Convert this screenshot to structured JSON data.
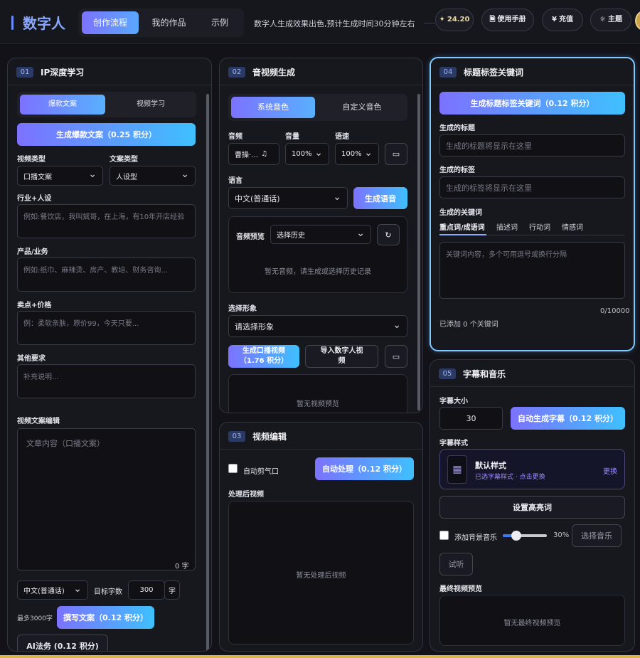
{
  "header": {
    "brand": "数字人",
    "tabs": [
      {
        "label": "创作流程",
        "active": true
      },
      {
        "label": "我的作品",
        "active": false
      },
      {
        "label": "示例",
        "active": false
      }
    ],
    "slogan": "数字人生成效果出色,预计生成时间30分钟左右",
    "credits": "24.20",
    "manual": "使用手册",
    "recharge": "充值",
    "theme": "主题"
  },
  "p1": {
    "num": "01",
    "title": "IP深度学习",
    "seg": [
      "爆款文案",
      "视频学习"
    ],
    "gen_button": "生成爆款文案（0.25 积分）",
    "video_type_label": "视频类型",
    "video_type_value": "口播文案",
    "copy_type_label": "文案类型",
    "copy_type_value": "人设型",
    "industry_label": "行业+人设",
    "industry_placeholder": "例如:餐饮店，我叫斌哥，在上海，有10年开店经验",
    "product_label": "产品/业务",
    "product_placeholder": "例如:纸巾、麻辣烫、房产、教培、财务咨询...",
    "selling_label": "卖点+价格",
    "selling_placeholder": "例：柔软亲肤，原价99，今天只要...",
    "other_label": "其他要求",
    "other_placeholder": "补充说明...",
    "editor_label": "视频文案编辑",
    "editor_placeholder": "文章内容（口播文案）",
    "char_count": "0 字",
    "lang_value": "中文(普通话)",
    "target_label": "目标字数",
    "target_value": "300",
    "unit": "字",
    "max_note": "最多3000字",
    "write_button": "撰写文案（0.12 积分）",
    "legal_button": "AI法务 (0.12 积分)"
  },
  "p2": {
    "num": "02",
    "title": "音视频生成",
    "seg": [
      "系统音色",
      "自定义音色"
    ],
    "audio_label": "音频",
    "audio_value": "曹操·…",
    "volume_label": "音量",
    "volume_value": "100%",
    "speed_label": "语速",
    "speed_value": "100%",
    "lang_label": "语言",
    "lang_value": "中文(普通话)",
    "gen_voice": "生成语音",
    "preview_label": "音频预览",
    "history_value": "选择历史",
    "no_audio": "暂无音频，请生成或选择历史记录",
    "avatar_label": "选择形象",
    "avatar_value": "请选择形象",
    "gen_video": "生成口播视频\n（1.76 积分）",
    "import_video": "导入数字人视\n频",
    "no_video": "暂无视频预览"
  },
  "p3": {
    "num": "03",
    "title": "视频编辑",
    "auto_cut_label": "自动剪气口",
    "auto_process": "自动处理（0.12 积分）",
    "processed_label": "处理后视频",
    "no_processed": "暂无处理后视频"
  },
  "p4": {
    "num": "04",
    "title": "标题标签关键词",
    "gen_button": "生成标题标签关键词（0.12 积分）",
    "title_label": "生成的标题",
    "title_placeholder": "生成的标题将显示在这里",
    "tag_label": "生成的标签",
    "tag_placeholder": "生成的标签将显示在这里",
    "kw_label": "生成的关键词",
    "kw_tabs": [
      "重点词/成语词",
      "描述词",
      "行动词",
      "情感词"
    ],
    "kw_placeholder": "关键词内容，多个可用逗号或换行分隔",
    "kw_count": "0/10000",
    "kw_added": "已添加 0 个关键词"
  },
  "p5": {
    "num": "05",
    "title": "字幕和音乐",
    "size_label": "字幕大小",
    "size_value": "30",
    "auto_sub": "自动生成字幕（0.12 积分）",
    "style_label": "字幕样式",
    "style_name": "默认样式",
    "style_sub": "已选字幕样式 · 点击更换",
    "style_change": "更换",
    "highlight": "设置高亮词",
    "bgm_label": "添加背景音乐",
    "bgm_volume": 0.3,
    "bgm_volume_text": "30%",
    "choose_music": "选择音乐",
    "listen": "试听",
    "final_label": "最终视频预览",
    "no_final": "暂无最终视频预览"
  },
  "colors": {
    "accent_start": "#7c72ff",
    "accent_end": "#3fc0ff",
    "panel_bg": "#17171e",
    "page_bg": "#121218",
    "glow_border": "#7fc8ff"
  }
}
